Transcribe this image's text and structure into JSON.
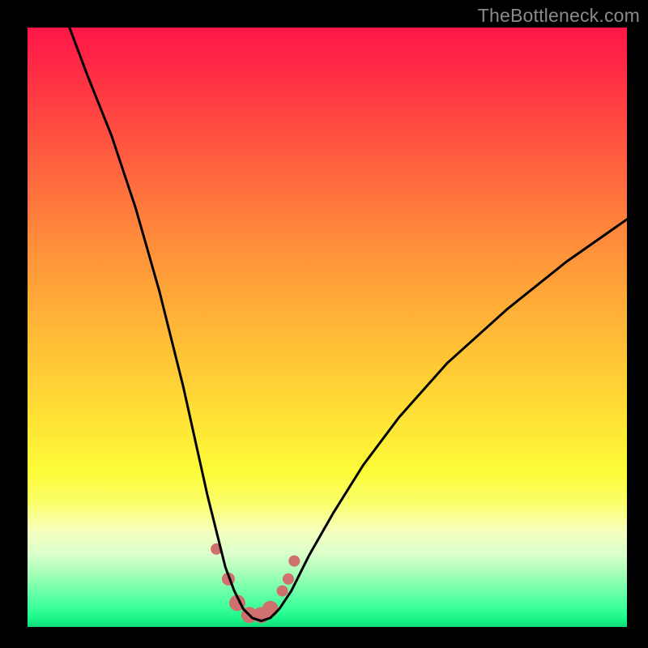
{
  "watermark": "TheBottleneck.com",
  "chart_data": {
    "type": "line",
    "title": "",
    "xlabel": "",
    "ylabel": "",
    "xlim": [
      0,
      100
    ],
    "ylim": [
      0,
      100
    ],
    "series": [
      {
        "name": "bottleneck-curve",
        "x": [
          7,
          10,
          14,
          18,
          22,
          26,
          28,
          30,
          31.5,
          33,
          34.5,
          36,
          37.5,
          39,
          40.5,
          42,
          44,
          47,
          51,
          56,
          62,
          70,
          80,
          90,
          100
        ],
        "values": [
          100,
          92,
          82,
          70,
          56,
          40,
          31,
          22,
          16,
          10,
          6,
          3,
          1.5,
          1,
          1.5,
          3,
          6,
          12,
          19,
          27,
          35,
          44,
          53,
          61,
          68
        ]
      }
    ],
    "markers": {
      "name": "highlight-dots",
      "x": [
        31.5,
        33.5,
        35,
        37,
        39,
        40.5,
        42.5,
        43.5,
        44.5
      ],
      "values": [
        13,
        8,
        4,
        2,
        2,
        3,
        6,
        8,
        11
      ],
      "radius": [
        7,
        8,
        10,
        10,
        10,
        10,
        7,
        7,
        7
      ]
    },
    "colors": {
      "curve": "#000000",
      "marker": "#cf6f6e"
    }
  }
}
